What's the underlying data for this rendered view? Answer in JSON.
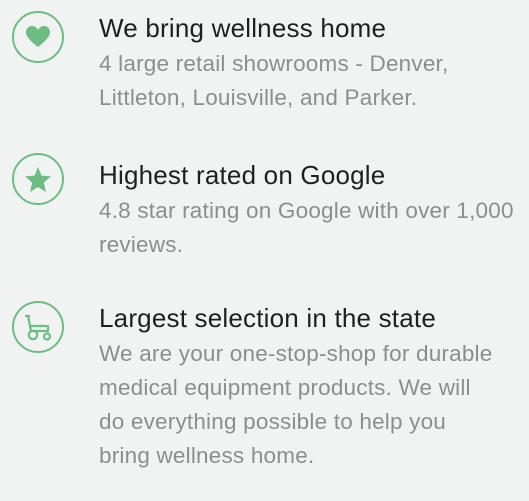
{
  "features": [
    {
      "icon": "heart-icon",
      "title": "We bring wellness home",
      "description": "4 large retail showrooms - Denver, Littleton, Louisville, and Parker."
    },
    {
      "icon": "star-icon",
      "title": "Highest rated on Google",
      "description": "4.8 star rating on Google with over 1,000 reviews."
    },
    {
      "icon": "wheelchair-icon",
      "title": "Largest selection in the state",
      "description": "We are your one-stop-shop for durable medical equipment products. We will do everything possible  to help you bring wellness home."
    }
  ],
  "colors": {
    "accent": "#6bbd84",
    "title": "#1f1f1f",
    "description": "#8a8f8c",
    "background": "#f1f3f2"
  }
}
